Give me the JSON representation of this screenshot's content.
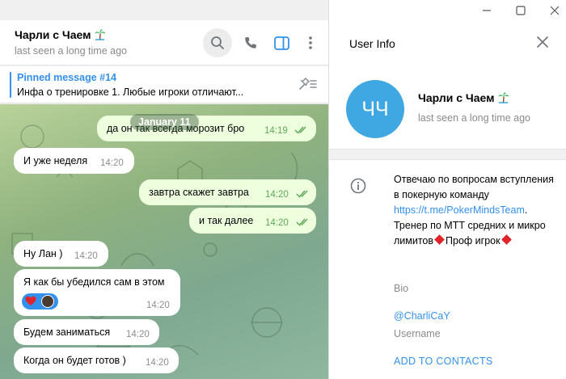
{
  "chat": {
    "title": "Чарли с Чаем",
    "status": "last seen a long time ago",
    "pinned": {
      "label": "Pinned message #14",
      "text": "Инфа о тренировке  1. Любые игроки отличают..."
    },
    "date_chip": "January 11",
    "messages": [
      {
        "direction": "out",
        "text": "да он так всегда морозит бро",
        "time": "14:19"
      },
      {
        "direction": "in",
        "text": "И уже неделя",
        "time": "14:20"
      },
      {
        "direction": "out",
        "text": "завтра скажет завтра",
        "time": "14:20"
      },
      {
        "direction": "out",
        "text": "и так далее",
        "time": "14:20"
      },
      {
        "direction": "in",
        "text": "Ну Лан )",
        "time": "14:20"
      },
      {
        "direction": "in",
        "text": "Я как бы убедился сам в этом",
        "time": "14:20"
      },
      {
        "direction": "in",
        "text": "Будем заниматься",
        "time": "14:20"
      },
      {
        "direction": "in",
        "text": "Когда он будет готов )",
        "time": "14:20"
      }
    ]
  },
  "info": {
    "title": "User Info",
    "avatar_initials": "ЧЧ",
    "name": "Чарли с Чаем",
    "status": "last seen a long time ago",
    "bio_line1": "Отвечаю по вопросам вступления в покерную команду",
    "bio_link": "https://t.me/PokerMindsTeam",
    "bio_line2": ". Тренер по МТТ средних и микро лимитов",
    "bio_line3": "Проф игрок",
    "bio_label": "Bio",
    "username": "@CharliCaY",
    "username_label": "Username",
    "add_contact": "ADD TO CONTACTS"
  },
  "colors": {
    "accent": "#3390ec",
    "outgoing_bubble": "#eeffde",
    "avatar": "#3fa7e2",
    "diamond": "#e0242a"
  }
}
